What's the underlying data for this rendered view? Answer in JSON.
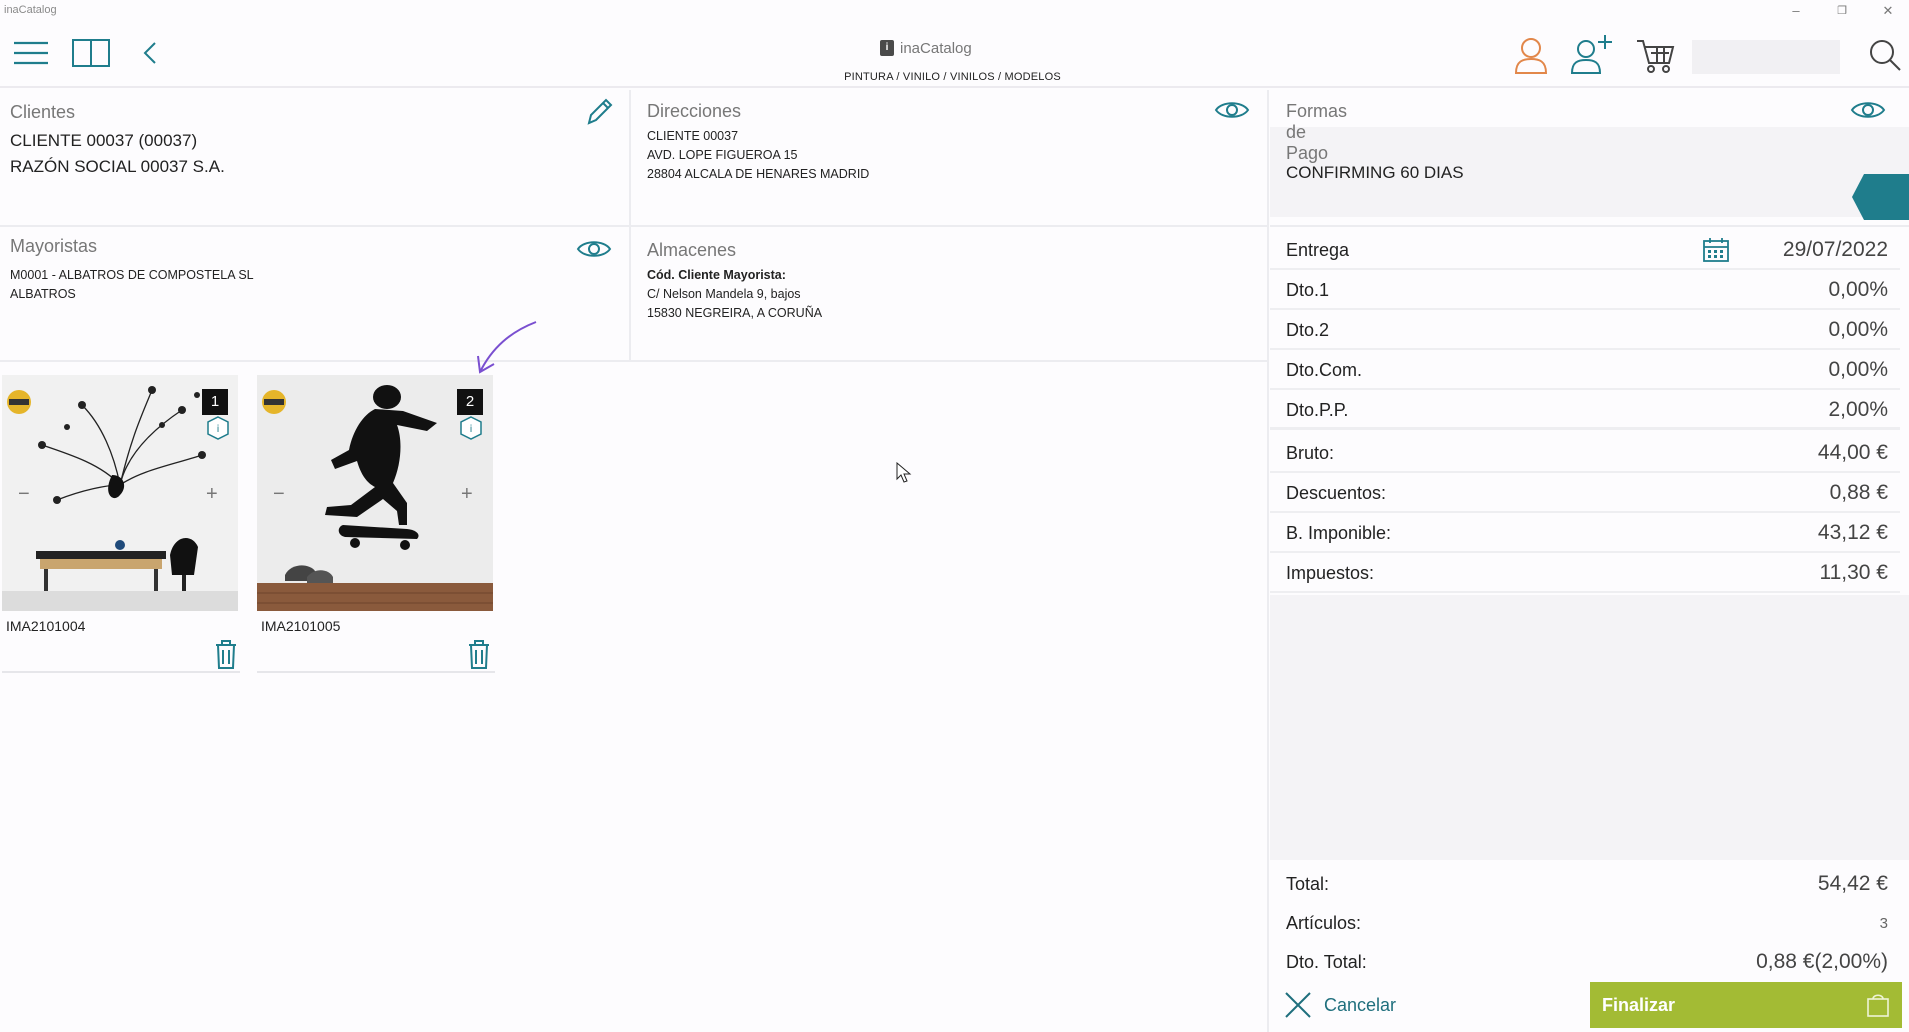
{
  "window": {
    "title": "inaCatalog"
  },
  "header": {
    "brand_name": "inaCatalog",
    "breadcrumb": "PINTURA / VINILO / VINILOS / MODELOS",
    "search_value": ""
  },
  "clientes": {
    "title": "Clientes",
    "client_line": "CLIENTE 00037 (00037)",
    "razon_line": "RAZÓN SOCIAL  00037 S.A."
  },
  "direcciones": {
    "title": "Direcciones",
    "lines": [
      "CLIENTE 00037",
      "AVD. LOPE FIGUEROA 15",
      "28804 ALCALA DE HENARES MADRID"
    ]
  },
  "formas_pago": {
    "title": "Formas de Pago",
    "value": "CONFIRMING 60 DIAS"
  },
  "mayoristas": {
    "title": "Mayoristas",
    "lines": [
      "M0001 - ALBATROS DE COMPOSTELA SL",
      "ALBATROS"
    ]
  },
  "almacenes": {
    "title": "Almacenes",
    "label": "Cód. Cliente Mayorista:",
    "lines": [
      "C/ Nelson Mandela 9, bajos",
      "15830 NEGREIRA, A CORUÑA"
    ]
  },
  "products": [
    {
      "code": "IMA2101004",
      "number": "1"
    },
    {
      "code": "IMA2101005",
      "number": "2"
    }
  ],
  "summary": {
    "entrega_label": "Entrega",
    "entrega_date": "29/07/2022",
    "rows": [
      {
        "label": "Dto.1",
        "value": "0,00%"
      },
      {
        "label": "Dto.2",
        "value": "0,00%"
      },
      {
        "label": "Dto.Com.",
        "value": "0,00%"
      },
      {
        "label": "Dto.P.P.",
        "value": "2,00%"
      },
      {
        "label": "Bruto:",
        "value": "44,00 €"
      },
      {
        "label": "Descuentos:",
        "value": "0,88 €"
      },
      {
        "label": "B. Imponible:",
        "value": "43,12 €"
      },
      {
        "label": "Impuestos:",
        "value": "11,30 €"
      }
    ]
  },
  "totals": {
    "total_label": "Total:",
    "total_value": "54,42 €",
    "articulos_label": "Artículos:",
    "articulos_value": "3",
    "dto_total_label": "Dto. Total:",
    "dto_total_value": "0,88 €(2,00%)"
  },
  "footer": {
    "cancel_label": "Cancelar",
    "finish_label": "Finalizar"
  },
  "colors": {
    "accent_teal": "#1f7d8c",
    "finish_green": "#a3bb34",
    "user_orange": "#e2874a"
  }
}
